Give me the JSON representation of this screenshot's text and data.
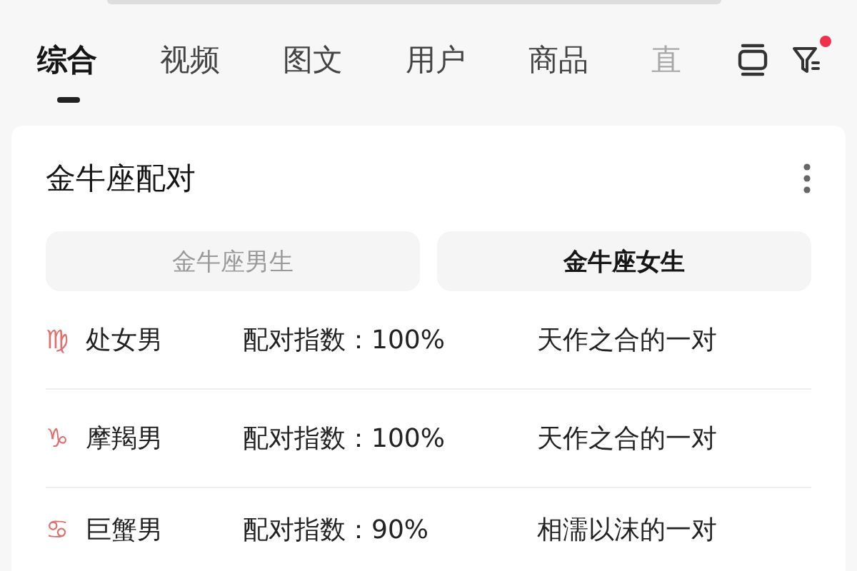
{
  "tabs": [
    {
      "label": "综合",
      "selected": true
    },
    {
      "label": "视频",
      "selected": false
    },
    {
      "label": "图文",
      "selected": false
    },
    {
      "label": "用户",
      "selected": false
    },
    {
      "label": "商品",
      "selected": false
    },
    {
      "label": "直",
      "selected": false,
      "faded": true
    }
  ],
  "filter_badge": true,
  "card": {
    "title": "金牛座配对",
    "segments": [
      {
        "label": "金牛座男生",
        "selected": false
      },
      {
        "label": "金牛座女生",
        "selected": true
      }
    ],
    "rows": [
      {
        "sign": "♍",
        "name": "处女男",
        "score": "配对指数：100%",
        "verdict": "天作之合的一对"
      },
      {
        "sign": "♑",
        "name": "摩羯男",
        "score": "配对指数：100%",
        "verdict": "天作之合的一对"
      },
      {
        "sign": "♋",
        "name": "巨蟹男",
        "score": "配对指数：90%",
        "verdict": "相濡以沫的一对"
      }
    ]
  }
}
